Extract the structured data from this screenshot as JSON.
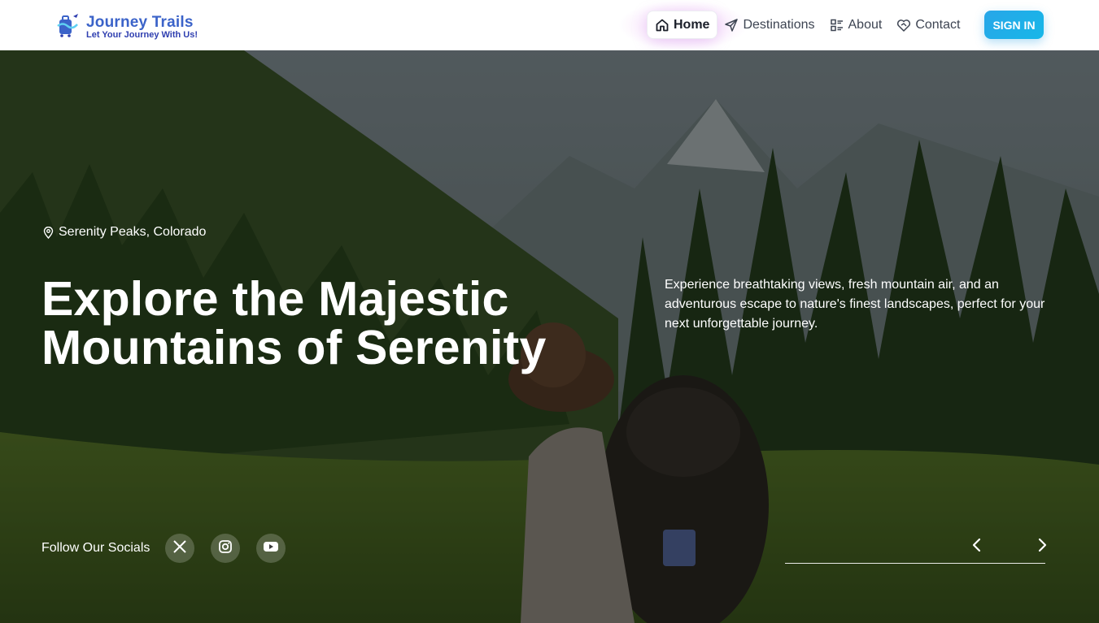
{
  "brand": {
    "title": "Journey Trails",
    "tagline": "Let Your Journey With Us!",
    "color": "#3b63c9"
  },
  "nav": {
    "items": [
      {
        "label": "Home",
        "icon": "home-icon",
        "active": true
      },
      {
        "label": "Destinations",
        "icon": "send-icon",
        "active": false
      },
      {
        "label": "About",
        "icon": "list-icon",
        "active": false
      },
      {
        "label": "Contact",
        "icon": "heart-handshake-icon",
        "active": false
      }
    ],
    "signin_label": "SIGN IN"
  },
  "hero": {
    "location": "Serenity Peaks, Colorado",
    "headline_line1": "Explore the Majestic",
    "headline_line2": "Mountains of Serenity",
    "description": "Experience breathtaking views, fresh mountain air, and an adventurous escape to nature's finest landscapes, perfect for your next unforgettable journey.",
    "socials_label": "Follow Our Socials",
    "socials": [
      "x-icon",
      "instagram-icon",
      "youtube-icon"
    ]
  },
  "colors": {
    "accent": "#17b7e8",
    "text_dark": "#3d4452"
  }
}
